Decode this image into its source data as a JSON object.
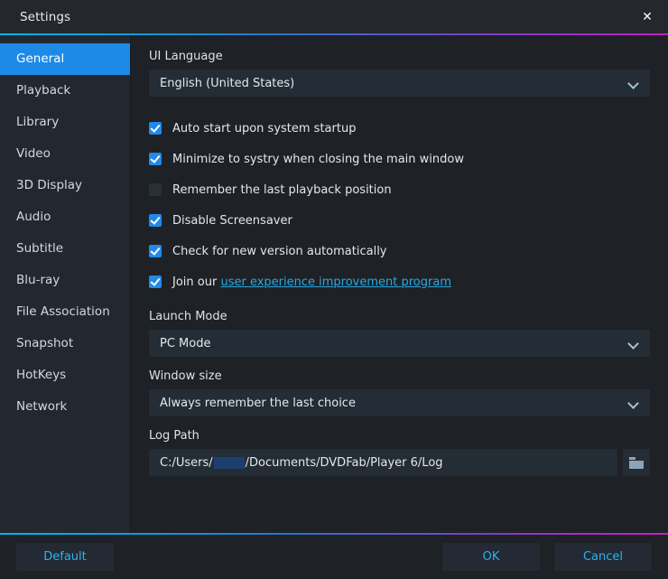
{
  "window": {
    "title": "Settings",
    "close_icon": "close-icon",
    "close_glyph": "✕",
    "accent_gradient_start": "#00b7e4",
    "accent_gradient_end": "#c41ec6"
  },
  "sidebar": {
    "items": [
      {
        "label": "General",
        "active": true
      },
      {
        "label": "Playback",
        "active": false
      },
      {
        "label": "Library",
        "active": false
      },
      {
        "label": "Video",
        "active": false
      },
      {
        "label": "3D Display",
        "active": false
      },
      {
        "label": "Audio",
        "active": false
      },
      {
        "label": "Subtitle",
        "active": false
      },
      {
        "label": "Blu-ray",
        "active": false
      },
      {
        "label": "File Association",
        "active": false
      },
      {
        "label": "Snapshot",
        "active": false
      },
      {
        "label": "HotKeys",
        "active": false
      },
      {
        "label": "Network",
        "active": false
      }
    ],
    "active_color": "#1e8ae8"
  },
  "main": {
    "ui_language": {
      "label": "UI Language",
      "value": "English (United States)",
      "chevron_icon": "chevron-down-icon"
    },
    "checkboxes": [
      {
        "label": "Auto start upon system startup",
        "checked": true
      },
      {
        "label": "Minimize to systry when closing the main window",
        "checked": true
      },
      {
        "label": "Remember the last playback position",
        "checked": false
      },
      {
        "label": "Disable Screensaver",
        "checked": true
      },
      {
        "label": "Check for new version automatically",
        "checked": true
      }
    ],
    "join_row": {
      "checked": true,
      "prefix": "Join our ",
      "link_text": "user experience improvement program",
      "link_color": "#29a8e0"
    },
    "launch_mode": {
      "label": "Launch Mode",
      "value": "PC Mode",
      "chevron_icon": "chevron-down-icon"
    },
    "window_size": {
      "label": "Window size",
      "value": "Always remember the last choice",
      "chevron_icon": "chevron-down-icon"
    },
    "log_path": {
      "label": "Log Path",
      "value_prefix": "C:/Users/",
      "value_suffix": "/Documents/DVDFab/Player 6/Log",
      "redacted": true,
      "browse_icon": "folder-icon"
    }
  },
  "footer": {
    "default_label": "Default",
    "ok_label": "OK",
    "cancel_label": "Cancel",
    "button_text_color": "#2db2ee"
  }
}
